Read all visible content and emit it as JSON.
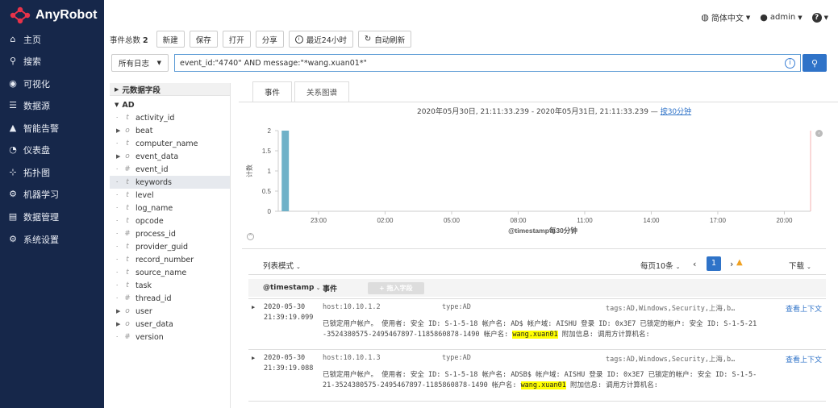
{
  "app": {
    "name": "AnyRobot"
  },
  "nav": [
    {
      "icon": "home-icon",
      "glyph": "⌂",
      "label": "主页"
    },
    {
      "icon": "search-icon",
      "glyph": "⚲",
      "label": "搜索"
    },
    {
      "icon": "eye-icon",
      "glyph": "◉",
      "label": "可视化"
    },
    {
      "icon": "database-icon",
      "glyph": "☰",
      "label": "数据源"
    },
    {
      "icon": "warning-icon",
      "glyph": "▲",
      "label": "智能告警"
    },
    {
      "icon": "dashboard-icon",
      "glyph": "◔",
      "label": "仪表盘"
    },
    {
      "icon": "topology-icon",
      "glyph": "⊹",
      "label": "拓扑图"
    },
    {
      "icon": "gears-icon",
      "glyph": "⚙",
      "label": "机器学习"
    },
    {
      "icon": "data-manage-icon",
      "glyph": "▤",
      "label": "数据管理"
    },
    {
      "icon": "settings-icon",
      "glyph": "⚙",
      "label": "系统设置"
    }
  ],
  "topbar": {
    "language": "简体中文",
    "user": "admin"
  },
  "toolbar": {
    "event_total_label": "事件总数",
    "event_total": "2",
    "new": "新建",
    "save": "保存",
    "open": "打开",
    "share": "分享",
    "timerange": "最近24小时",
    "autorefresh": "自动刷新"
  },
  "search": {
    "log_select": "所有日志",
    "query": "event_id:\"4740\" AND message:\"*wang.xuan01*\""
  },
  "fields": {
    "meta_label": "元数据字段",
    "group_label": "AD",
    "items": [
      {
        "type": "t",
        "name": "activity_id",
        "expand": false
      },
      {
        "type": "o",
        "name": "beat",
        "expand": true
      },
      {
        "type": "t",
        "name": "computer_name",
        "expand": false
      },
      {
        "type": "o",
        "name": "event_data",
        "expand": true
      },
      {
        "type": "#",
        "name": "event_id",
        "expand": false
      },
      {
        "type": "t",
        "name": "keywords",
        "expand": false
      },
      {
        "type": "t",
        "name": "level",
        "expand": false
      },
      {
        "type": "t",
        "name": "log_name",
        "expand": false
      },
      {
        "type": "t",
        "name": "opcode",
        "expand": false
      },
      {
        "type": "#",
        "name": "process_id",
        "expand": false
      },
      {
        "type": "t",
        "name": "provider_guid",
        "expand": false
      },
      {
        "type": "t",
        "name": "record_number",
        "expand": false
      },
      {
        "type": "t",
        "name": "source_name",
        "expand": false
      },
      {
        "type": "t",
        "name": "task",
        "expand": false
      },
      {
        "type": "#",
        "name": "thread_id",
        "expand": false
      },
      {
        "type": "o",
        "name": "user",
        "expand": true
      },
      {
        "type": "o",
        "name": "user_data",
        "expand": true
      },
      {
        "type": "#",
        "name": "version",
        "expand": false
      }
    ]
  },
  "tabs": [
    {
      "label": "事件"
    },
    {
      "label": "关系图谱"
    }
  ],
  "range": {
    "text": "2020年05月30日, 21:11:33.239 - 2020年05月31日, 21:11:33.239 —",
    "link": "按30分钟"
  },
  "chart_data": {
    "type": "bar",
    "ylabel": "计数",
    "xlabel": "@timestamp每30分钟",
    "yticks": [
      "0",
      "0.5",
      "1",
      "1.5",
      "2"
    ],
    "xticks": [
      "23:00",
      "02:00",
      "05:00",
      "08:00",
      "11:00",
      "14:00",
      "17:00",
      "20:00"
    ],
    "ylim": [
      0,
      2
    ],
    "bars": [
      {
        "x": "21:30",
        "value": 2
      }
    ]
  },
  "list": {
    "mode": "列表模式",
    "per_page": "每页10条",
    "page": "1",
    "download": "下载",
    "col_time": "@timestamp",
    "col_event": "事件",
    "add_field": "+ 拖入字段"
  },
  "events": [
    {
      "date": "2020-05-30",
      "time": "21:39:19.099",
      "host": "host:10.10.1.2",
      "type": "type:AD",
      "tags": "tags:AD,Windows,Security,上海,b…",
      "ctx": "查看上下文",
      "line1": "已锁定用户帐户。 使用者: 安全 ID: S-1-5-18 帐户名: AD$ 帐户域: AISHU 登录 ID: 0x3E7 已锁定的帐户: 安全 ID: S-1-5-21",
      "line2a": "-3524380575-2495467897-1185860878-1490 帐户名:",
      "hl": "wang.xuan01",
      "line2b": "附加信息: 调用方计算机名:"
    },
    {
      "date": "2020-05-30",
      "time": "21:39:19.088",
      "host": "host:10.10.1.3",
      "type": "type:AD",
      "tags": "tags:AD,Windows,Security,上海,b…",
      "ctx": "查看上下文",
      "line1": "已锁定用户帐户。 使用者: 安全 ID: S-1-5-18 帐户名: ADSB$ 帐户域: AISHU 登录 ID: 0x3E7 已锁定的帐户: 安全 ID: S-1-5-",
      "line2a": "21-3524380575-2495467897-1185860878-1490 帐户名:",
      "hl": "wang.xuan01",
      "line2b": "附加信息: 调用方计算机名:"
    }
  ]
}
